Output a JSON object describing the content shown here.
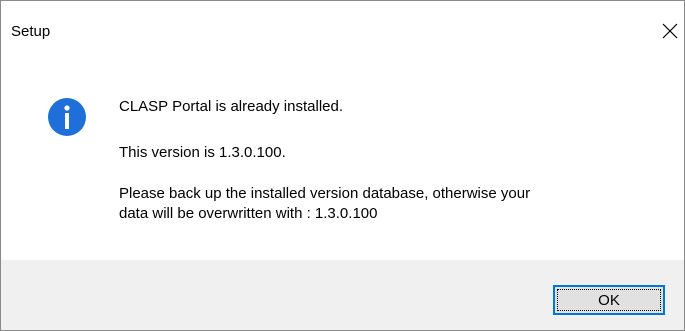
{
  "window": {
    "title": "Setup"
  },
  "icons": {
    "info": "info-icon",
    "close": "close-icon"
  },
  "colors": {
    "info_icon": "#1e6fd9",
    "ok_focus_border": "#0078d7",
    "footer_bg": "#f0f0f0"
  },
  "message": {
    "line1": "CLASP Portal is already installed.",
    "line2": "This version is 1.3.0.100.",
    "line3": "Please back up the installed version database, otherwise your",
    "line4": "data will be overwritten with : 1.3.0.100"
  },
  "buttons": {
    "ok_label": "OK"
  }
}
